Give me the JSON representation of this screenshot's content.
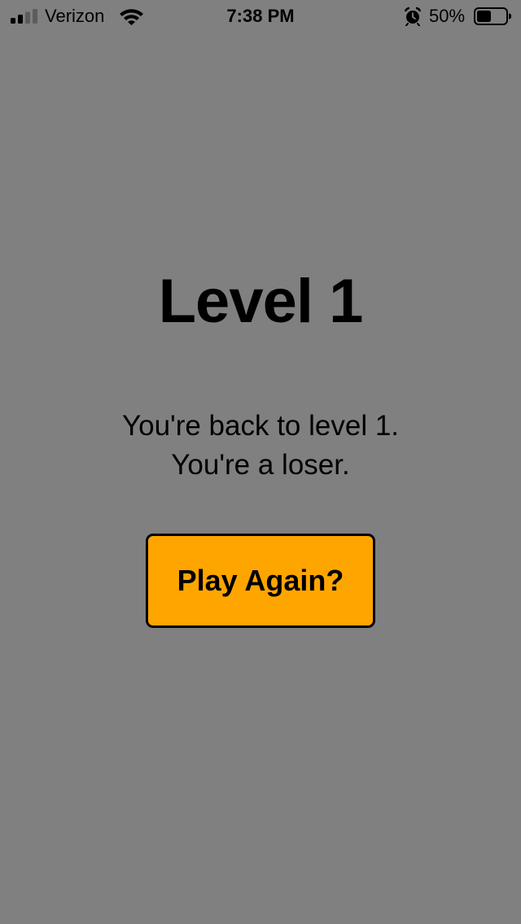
{
  "status_bar": {
    "carrier": "Verizon",
    "time": "7:38 PM",
    "battery_percent": "50%",
    "battery_level": 0.5,
    "signal_bars_filled": 2,
    "signal_bars_total": 4,
    "icons": [
      "signal-icon",
      "wifi-icon",
      "alarm-icon",
      "battery-icon"
    ]
  },
  "screen": {
    "title": "Level 1",
    "message_lines": [
      "You're back to level 1.",
      "You're a loser."
    ],
    "button_label": "Play Again?"
  },
  "colors": {
    "background": "#808080",
    "button": "#ffa500",
    "text": "#000000"
  }
}
